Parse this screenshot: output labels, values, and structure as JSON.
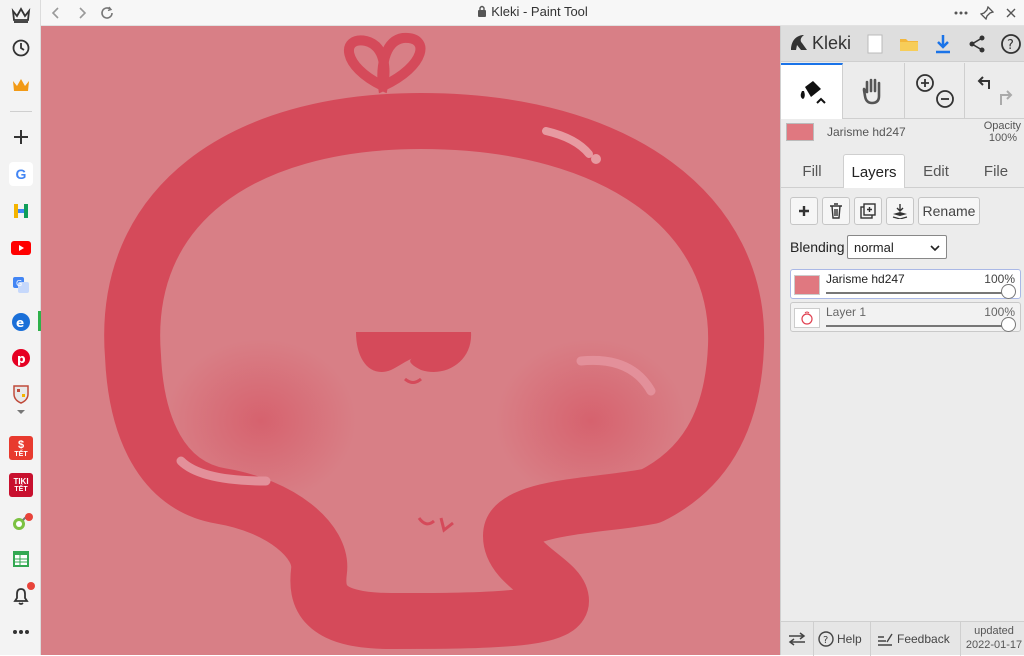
{
  "window": {
    "title": "Kleki - Paint Tool"
  },
  "app": {
    "name": "Kleki"
  },
  "current_layer": {
    "name": "Jarisme hd247",
    "opacity_label": "Opacity",
    "opacity_value": "100%"
  },
  "tabs": [
    {
      "label": "Fill"
    },
    {
      "label": "Layers"
    },
    {
      "label": "Edit"
    },
    {
      "label": "File"
    }
  ],
  "layer_buttons": {
    "rename_label": "Rename"
  },
  "blending": {
    "label": "Blending",
    "value": "normal",
    "options": [
      "normal"
    ]
  },
  "layers": [
    {
      "name": "Jarisme hd247",
      "opacity": "100%"
    },
    {
      "name": "Layer 1",
      "opacity": "100%"
    }
  ],
  "footer": {
    "help_label": "Help",
    "feedback_label": "Feedback",
    "updated_label": "updated",
    "updated_date": "2022-01-17"
  },
  "sidebar_badges": {
    "tet1": "TẾT",
    "tet2": "TẾT",
    "tiki": "TIKI"
  },
  "colors": {
    "canvas": "#d87f86",
    "drawing": "#d54a5a",
    "accent_blue": "#1a73e8"
  }
}
